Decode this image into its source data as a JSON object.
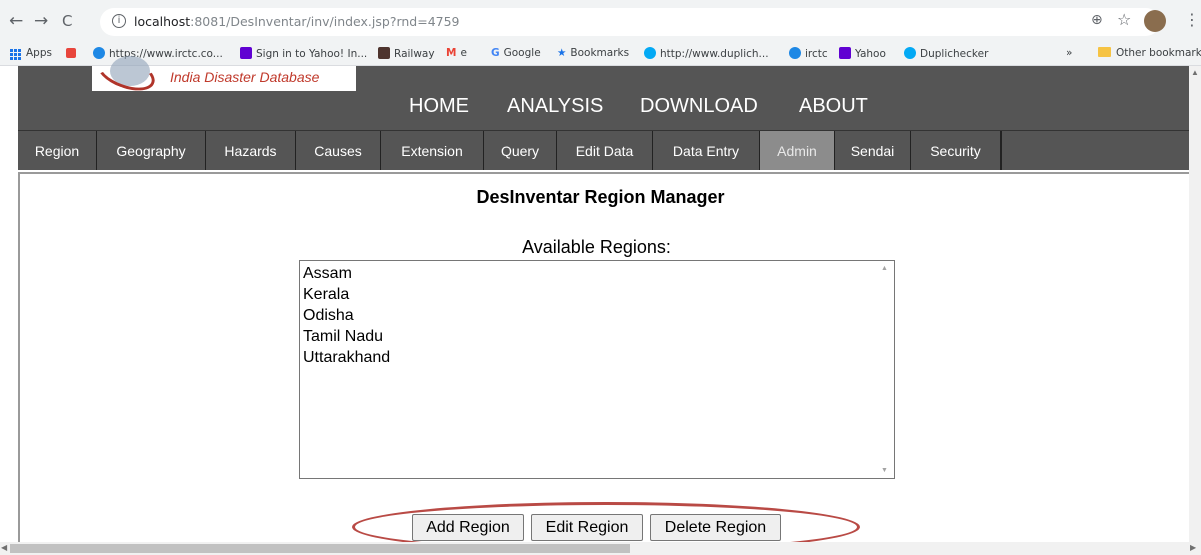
{
  "browser": {
    "url_host": "localhost",
    "url_rest": ":8081/DesInventar/inv/index.jsp?rnd=4759",
    "back_icon": "←",
    "forward_icon": "→",
    "reload_icon": "C",
    "info_icon": "i",
    "zoom_icon": "⊕",
    "star_icon": "☆",
    "menu_icon": "⋮"
  },
  "bookmarks": {
    "apps": "Apps",
    "items": [
      {
        "label": "https://www.irctc.co...",
        "color": "#1e88e5"
      },
      {
        "label": "Sign in to Yahoo! In...",
        "color": "#6001d2"
      },
      {
        "label": "Railway",
        "color": "#4e342e"
      },
      {
        "label": "e",
        "color": "#ea4335"
      },
      {
        "label": "Google",
        "color": "#4285f4"
      },
      {
        "label": "Bookmarks",
        "color": "#1a73e8"
      },
      {
        "label": "http://www.duplich...",
        "color": "#03a9f4"
      },
      {
        "label": "irctc",
        "color": "#1e88e5"
      },
      {
        "label": "Yahoo",
        "color": "#6001d2"
      },
      {
        "label": "Duplichecker",
        "color": "#03a9f4"
      }
    ],
    "more": "»",
    "other": "Other bookmarks"
  },
  "site": {
    "logo_text": "India Disaster Database",
    "top_nav": [
      "HOME",
      "ANALYSIS",
      "DOWNLOAD",
      "ABOUT"
    ],
    "menu": [
      "Region",
      "Geography",
      "Hazards",
      "Causes",
      "Extension",
      "Query",
      "Edit Data",
      "Data Entry",
      "Admin",
      "Sendai",
      "Security"
    ],
    "active_menu": "Admin"
  },
  "manager": {
    "title": "DesInventar Region Manager",
    "available_label": "Available Regions:",
    "regions": [
      "Assam",
      "Kerala",
      "Odisha",
      "Tamil Nadu",
      "Uttarakhand"
    ],
    "buttons": {
      "add": "Add Region",
      "edit": "Edit Region",
      "delete": "Delete Region"
    }
  },
  "colors": {
    "header_bg": "#555555",
    "active_menu_bg": "#8c8c8c",
    "highlight_oval": "#b94a45",
    "logo_text": "#c0392b"
  }
}
